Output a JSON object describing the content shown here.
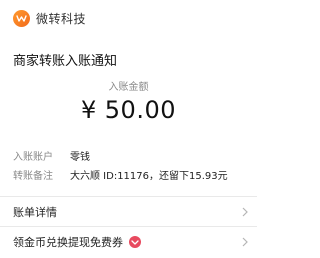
{
  "header": {
    "brand_name": "微转科技"
  },
  "notice": {
    "title": "商家转账入账通知"
  },
  "amount": {
    "label": "入账金额",
    "currency": "¥",
    "value": "50.00"
  },
  "details": [
    {
      "label": "入账账户",
      "value": "零钱"
    },
    {
      "label": "转账备注",
      "value": "大六顺 ID:11176，还留下15.93元"
    }
  ],
  "links": {
    "details_label": "账单详情",
    "promo_label": "领金币兑换提现免费券"
  },
  "colors": {
    "brand_orange": "#f26a1b",
    "gift_red": "#e84a5f"
  }
}
